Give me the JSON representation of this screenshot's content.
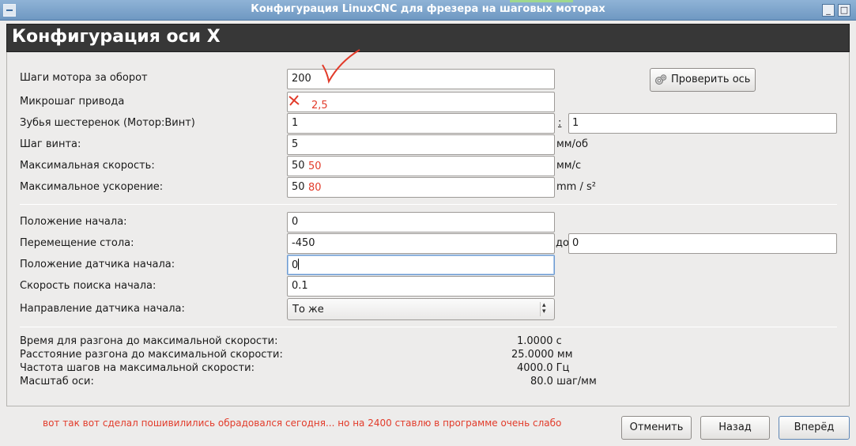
{
  "window": {
    "title": "Конфигурация LinuxCNC для фрезера на шаговых моторах"
  },
  "header": {
    "title": "Конфигурация оси X"
  },
  "motor": [
    {
      "label": "Шаги мотора за оборот",
      "value": "200",
      "unit": ""
    },
    {
      "label": "Микрошаг привода",
      "value": "",
      "unit": ""
    },
    {
      "label": "Зубья шестеренок (Мотор:Винт)",
      "value": "1",
      "sep": ":",
      "value2": "1"
    },
    {
      "label": "Шаг винта:",
      "value": "5",
      "unit": "мм/об"
    },
    {
      "label": "Максимальная скорость:",
      "value": "50",
      "unit": "мм/с"
    },
    {
      "label": "Максимальное ускорение:",
      "value": "50",
      "unit": "mm / s²"
    }
  ],
  "home": [
    {
      "label": "Положение начала:",
      "value": "0"
    },
    {
      "label": "Перемещение стола:",
      "value": "-450",
      "sep": "до",
      "value2": "0"
    },
    {
      "label": "Положение датчика начала:",
      "value": "0"
    },
    {
      "label": "Скорость поиска начала:",
      "value": "0.1"
    },
    {
      "label": "Направление датчика начала:",
      "selected": "То же"
    }
  ],
  "info": [
    {
      "label": "Время для разгона до максимальной скорости:",
      "value": "1.0000 с"
    },
    {
      "label": "Расстояние разгона до максимальной скорости:",
      "value": "25.0000 мм"
    },
    {
      "label": "Частота шагов на максимальной скорости:",
      "value": "4000.0 Гц"
    },
    {
      "label": "Масштаб оси:",
      "value": "80.0 шаг/мм"
    }
  ],
  "buttons": {
    "test_axis": "Проверить ось",
    "cancel": "Отменить",
    "back": "Назад",
    "forward": "Вперёд"
  },
  "annotations": {
    "microstep": "2,5",
    "max_velocity": "50",
    "max_accel": "80",
    "note": "вот так вот сделал пошивилились обрадовался сегодня... но на 2400 ставлю в программе очень слабо"
  },
  "colors": {
    "annotation": "#e23b2a",
    "titlebar": "#7aa3cc",
    "header": "#373737"
  },
  "icons": {
    "app": "app-icon",
    "test_axis": "gears-icon",
    "combo": "updown-chevron-icon"
  }
}
